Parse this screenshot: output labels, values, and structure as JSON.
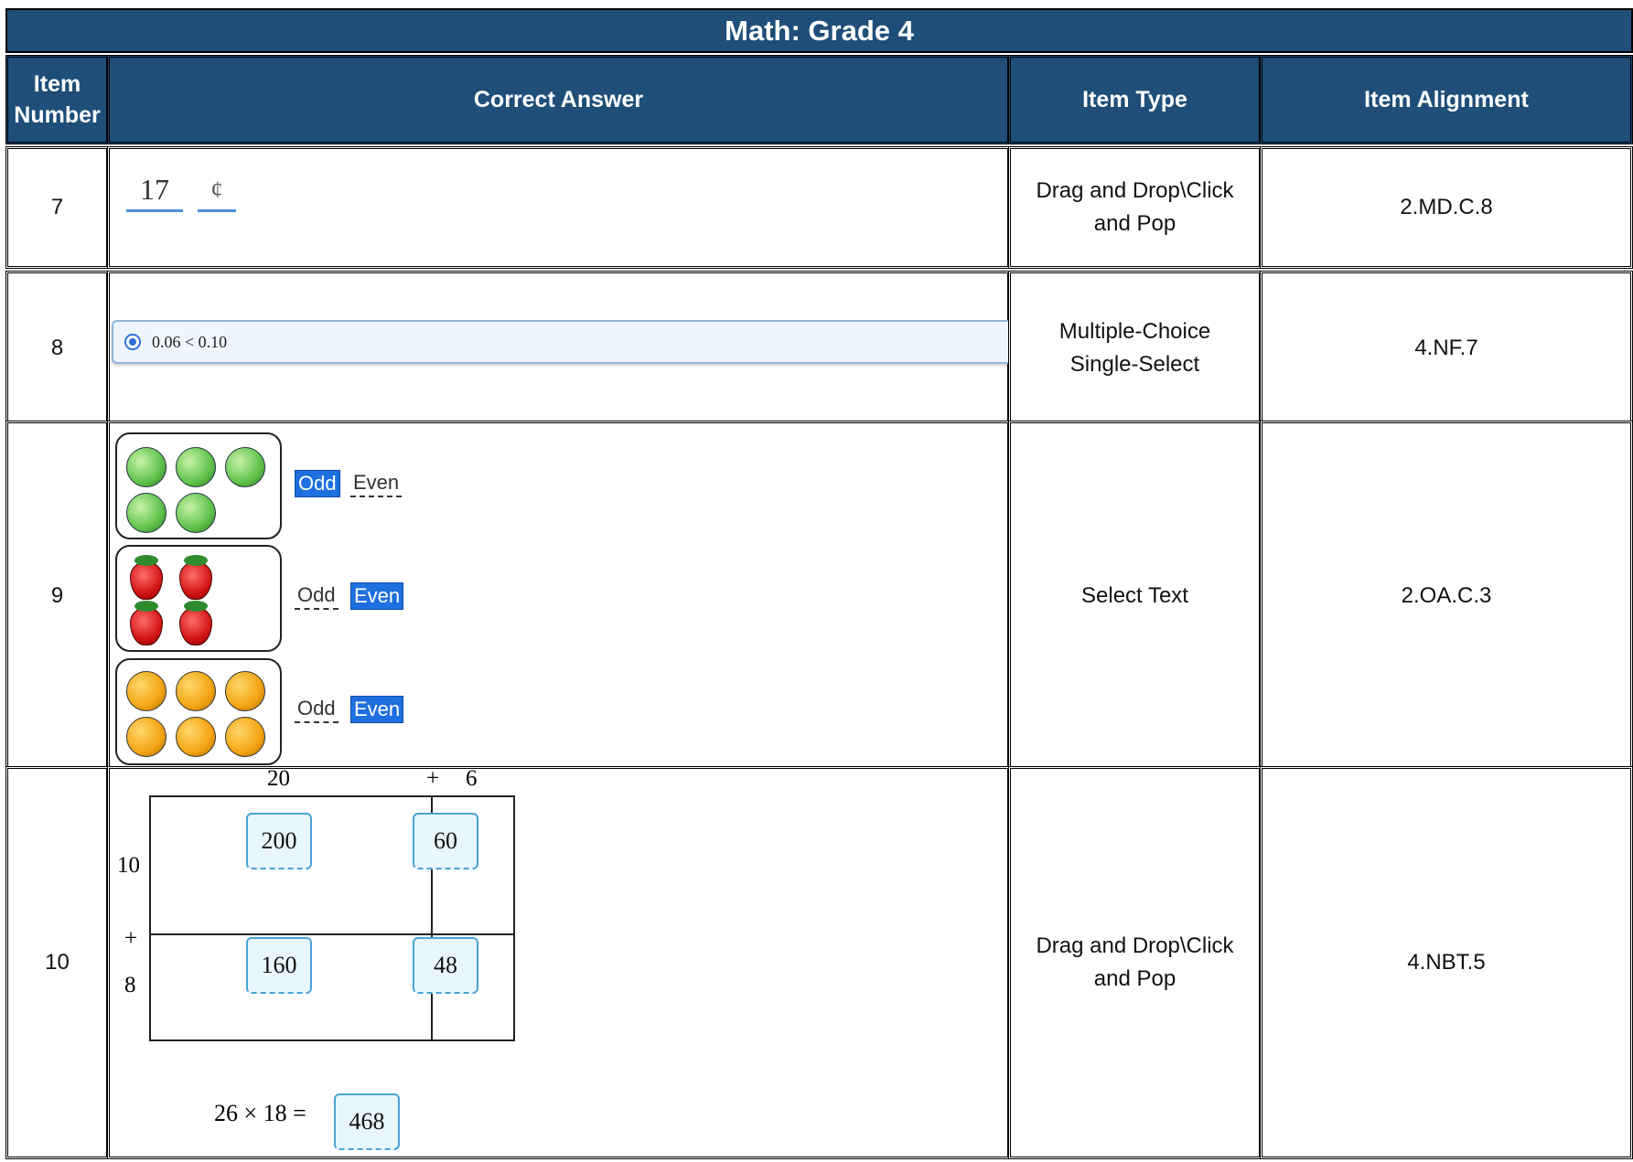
{
  "table": {
    "title": "Math: Grade 4",
    "headers": {
      "item_number": "Item Number",
      "correct_answer": "Correct Answer",
      "item_type": "Item Type",
      "item_alignment": "Item Alignment"
    },
    "rows": [
      {
        "item_number": "7",
        "answer": {
          "value": "17",
          "unit": "¢"
        },
        "item_type": "Drag and Drop\\Click and Pop",
        "item_alignment": "2.MD.C.8"
      },
      {
        "item_number": "8",
        "answer": {
          "selected_choice": "0.06 < 0.10"
        },
        "item_type": "Multiple-Choice Single-Select",
        "item_alignment": "4.NF.7"
      },
      {
        "item_number": "9",
        "answer": {
          "groups": [
            {
              "fruit": "apple",
              "count": 5,
              "odd_label": "Odd",
              "even_label": "Even",
              "selected": "Odd"
            },
            {
              "fruit": "strawberry",
              "count": 4,
              "odd_label": "Odd",
              "even_label": "Even",
              "selected": "Even"
            },
            {
              "fruit": "orange",
              "count": 6,
              "odd_label": "Odd",
              "even_label": "Even",
              "selected": "Even"
            }
          ]
        },
        "item_type": "Select Text",
        "item_alignment": "2.OA.C.3"
      },
      {
        "item_number": "10",
        "answer": {
          "top_left": "20",
          "top_plus": "+",
          "top_right": "6",
          "side_top": "10",
          "side_plus": "+",
          "side_bottom": "8",
          "cells": [
            "200",
            "60",
            "160",
            "48"
          ],
          "equation": "26 × 18 =",
          "product": "468"
        },
        "item_type": "Drag and Drop\\Click and Pop",
        "item_alignment": "4.NBT.5"
      }
    ]
  },
  "colors": {
    "header_bg": "#1f4e79",
    "header_text": "#ffffff",
    "select_blue": "#1e6fe0"
  }
}
